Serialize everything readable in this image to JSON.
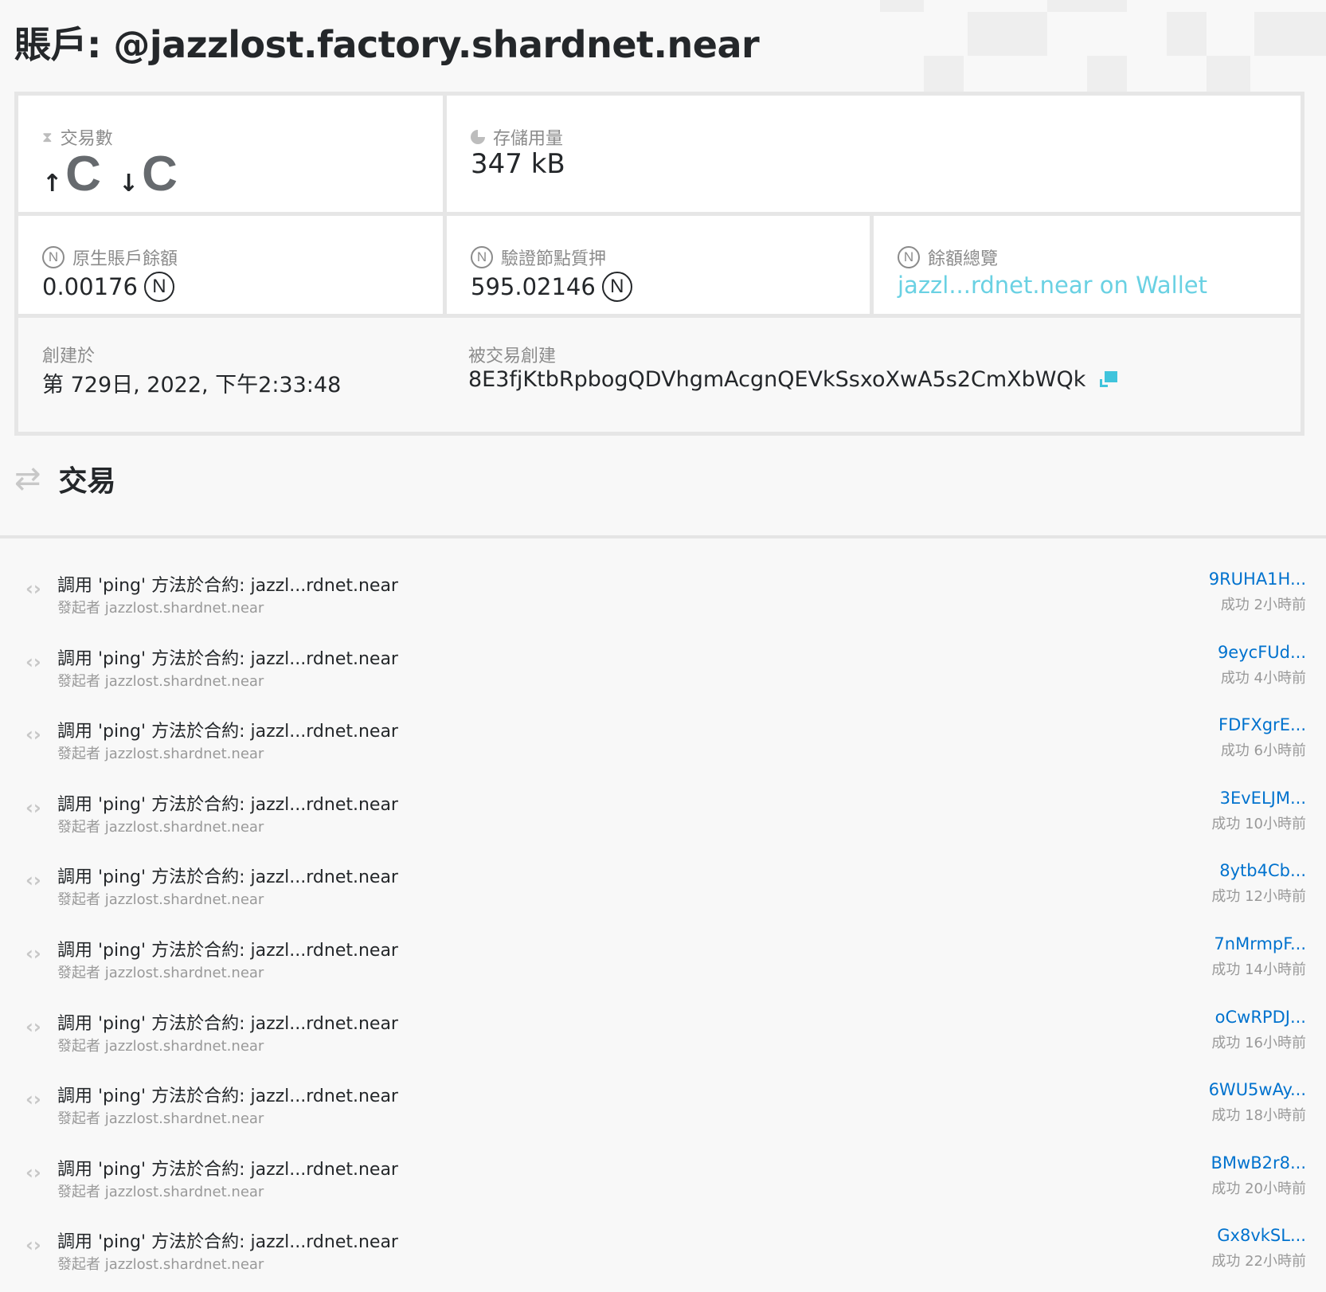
{
  "page": {
    "title": "賬戶: @jazzlost.factory.shardnet.near"
  },
  "stats": {
    "transactions": {
      "label": "交易數",
      "in_arrow": "↑",
      "out_arrow": "↓"
    },
    "storage": {
      "label": "存儲用量",
      "value": "347 kB"
    },
    "native_balance": {
      "label": "原生賬戶餘額",
      "value": "0.00176"
    },
    "validator_stake": {
      "label": "驗證節點質押",
      "value": "595.02146"
    },
    "balance_overview": {
      "label": "餘額總覽",
      "link": "jazzl...rdnet.near on Wallet"
    },
    "created_at": {
      "label": "創建於",
      "value": "第 729日, 2022, 下午2:33:48"
    },
    "created_by_tx": {
      "label": "被交易創建",
      "value": "8E3fjKtbRpbogQDVhgmAcgnQEVkSsxoXwA5s2CmXbWQk"
    }
  },
  "section": {
    "title": "交易"
  },
  "transactions": [
    {
      "title": "調用 'ping' 方法於合約: jazzl...rdnet.near",
      "signer": "發起者 jazzlost.shardnet.near",
      "hash": "9RUHA1H...",
      "status": "成功 2小時前"
    },
    {
      "title": "調用 'ping' 方法於合約: jazzl...rdnet.near",
      "signer": "發起者 jazzlost.shardnet.near",
      "hash": "9eycFUd...",
      "status": "成功 4小時前"
    },
    {
      "title": "調用 'ping' 方法於合約: jazzl...rdnet.near",
      "signer": "發起者 jazzlost.shardnet.near",
      "hash": "FDFXgrE...",
      "status": "成功 6小時前"
    },
    {
      "title": "調用 'ping' 方法於合約: jazzl...rdnet.near",
      "signer": "發起者 jazzlost.shardnet.near",
      "hash": "3EvELJM...",
      "status": "成功 10小時前"
    },
    {
      "title": "調用 'ping' 方法於合約: jazzl...rdnet.near",
      "signer": "發起者 jazzlost.shardnet.near",
      "hash": "8ytb4Cb...",
      "status": "成功 12小時前"
    },
    {
      "title": "調用 'ping' 方法於合約: jazzl...rdnet.near",
      "signer": "發起者 jazzlost.shardnet.near",
      "hash": "7nMrmpF...",
      "status": "成功 14小時前"
    },
    {
      "title": "調用 'ping' 方法於合約: jazzl...rdnet.near",
      "signer": "發起者 jazzlost.shardnet.near",
      "hash": "oCwRPDJ...",
      "status": "成功 16小時前"
    },
    {
      "title": "調用 'ping' 方法於合約: jazzl...rdnet.near",
      "signer": "發起者 jazzlost.shardnet.near",
      "hash": "6WU5wAy...",
      "status": "成功 18小時前"
    },
    {
      "title": "調用 'ping' 方法於合約: jazzl...rdnet.near",
      "signer": "發起者 jazzlost.shardnet.near",
      "hash": "BMwB2r8...",
      "status": "成功 20小時前"
    },
    {
      "title": "調用 'ping' 方法於合約: jazzl...rdnet.near",
      "signer": "發起者 jazzlost.shardnet.near",
      "hash": "Gx8vkSL...",
      "status": "成功 22小時前"
    }
  ],
  "icons": {
    "transactions": "hourglass-icon",
    "storage": "pie-chart-icon",
    "near": "near-token-icon",
    "swap": "swap-arrows-icon",
    "call": "code-brackets-icon",
    "copy": "external-copy-icon"
  },
  "colors": {
    "link": "#0072ce",
    "wallet_link": "#6ad1e3",
    "copy_icon": "#40c4dc"
  }
}
